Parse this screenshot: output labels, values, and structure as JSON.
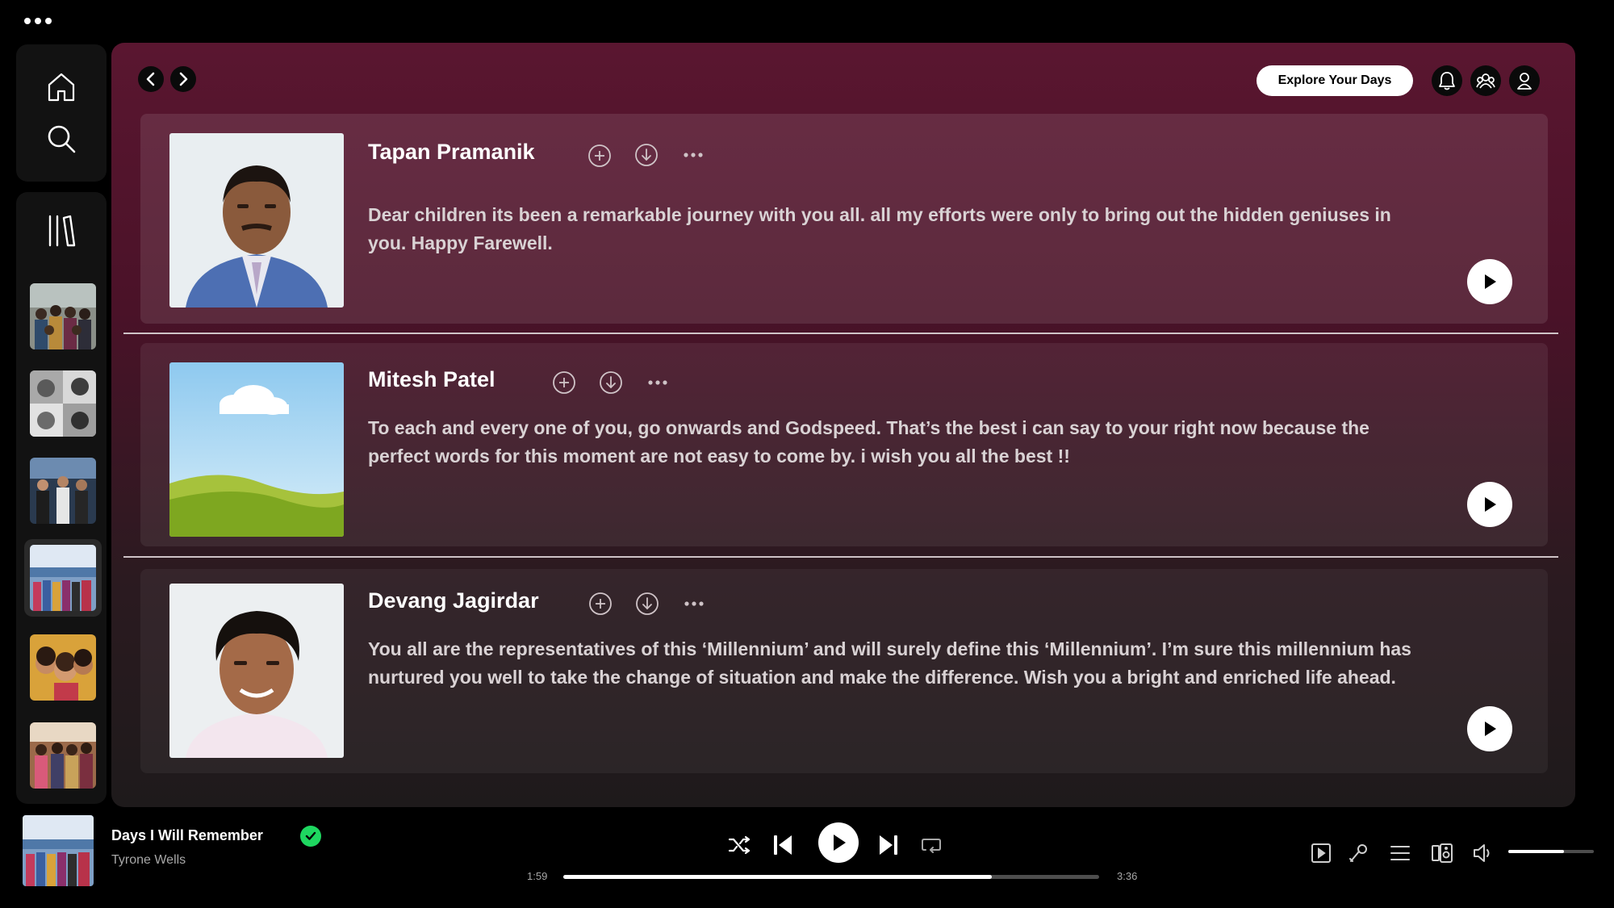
{
  "colors": {
    "accent_green": "#1ed760",
    "panel_top": "#5a1630",
    "panel_bottom": "#1e1a1b",
    "card_bg": "#ffffff14"
  },
  "nav": {
    "icons": [
      "home-icon",
      "search-icon",
      "library-icon"
    ]
  },
  "library": {
    "items": [
      {
        "name": "playlist-group-photo-1"
      },
      {
        "name": "playlist-portraits-collage"
      },
      {
        "name": "playlist-group-photo-2"
      },
      {
        "name": "playlist-group-photo-3",
        "active": true
      },
      {
        "name": "playlist-selfie"
      },
      {
        "name": "playlist-group-photo-4"
      }
    ]
  },
  "header": {
    "explore_label": "Explore Your Days",
    "icons": [
      "bell-icon",
      "friends-icon",
      "profile-icon"
    ]
  },
  "cards": [
    {
      "name": "Tapan Pramanik",
      "message": "Dear children its been a remarkable journey with you all. all my efforts were only to bring out the hidden geniuses in you. Happy Farewell."
    },
    {
      "name": "Mitesh Patel",
      "message": "To each and every one of you, go onwards and Godspeed. That’s the best i can say to your right now because the perfect words for this moment are not easy to come by. i wish you all the best !!"
    },
    {
      "name": "Devang Jagirdar",
      "message": "You all are the representatives of this ‘Millennium’ and will surely define this ‘Millennium’. I’m sure this millennium has nurtured you well to take the change of situation and make the difference. Wish you a bright and enriched life ahead."
    }
  ],
  "player": {
    "title": "Days I Will Remember",
    "artist": "Tyrone Wells",
    "elapsed": "1:59",
    "duration": "3:36",
    "progress": 0.8,
    "volume": 0.65
  }
}
